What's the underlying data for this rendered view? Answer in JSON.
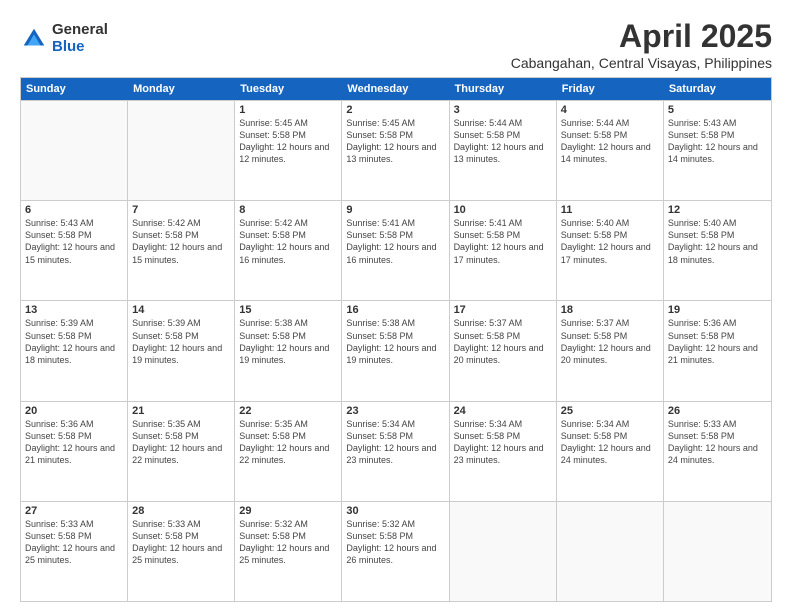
{
  "logo": {
    "general": "General",
    "blue": "Blue"
  },
  "title": "April 2025",
  "location": "Cabangahan, Central Visayas, Philippines",
  "days": [
    "Sunday",
    "Monday",
    "Tuesday",
    "Wednesday",
    "Thursday",
    "Friday",
    "Saturday"
  ],
  "weeks": [
    [
      {
        "day": "",
        "sunrise": "",
        "sunset": "",
        "daylight": ""
      },
      {
        "day": "",
        "sunrise": "",
        "sunset": "",
        "daylight": ""
      },
      {
        "day": "1",
        "sunrise": "Sunrise: 5:45 AM",
        "sunset": "Sunset: 5:58 PM",
        "daylight": "Daylight: 12 hours and 12 minutes."
      },
      {
        "day": "2",
        "sunrise": "Sunrise: 5:45 AM",
        "sunset": "Sunset: 5:58 PM",
        "daylight": "Daylight: 12 hours and 13 minutes."
      },
      {
        "day": "3",
        "sunrise": "Sunrise: 5:44 AM",
        "sunset": "Sunset: 5:58 PM",
        "daylight": "Daylight: 12 hours and 13 minutes."
      },
      {
        "day": "4",
        "sunrise": "Sunrise: 5:44 AM",
        "sunset": "Sunset: 5:58 PM",
        "daylight": "Daylight: 12 hours and 14 minutes."
      },
      {
        "day": "5",
        "sunrise": "Sunrise: 5:43 AM",
        "sunset": "Sunset: 5:58 PM",
        "daylight": "Daylight: 12 hours and 14 minutes."
      }
    ],
    [
      {
        "day": "6",
        "sunrise": "Sunrise: 5:43 AM",
        "sunset": "Sunset: 5:58 PM",
        "daylight": "Daylight: 12 hours and 15 minutes."
      },
      {
        "day": "7",
        "sunrise": "Sunrise: 5:42 AM",
        "sunset": "Sunset: 5:58 PM",
        "daylight": "Daylight: 12 hours and 15 minutes."
      },
      {
        "day": "8",
        "sunrise": "Sunrise: 5:42 AM",
        "sunset": "Sunset: 5:58 PM",
        "daylight": "Daylight: 12 hours and 16 minutes."
      },
      {
        "day": "9",
        "sunrise": "Sunrise: 5:41 AM",
        "sunset": "Sunset: 5:58 PM",
        "daylight": "Daylight: 12 hours and 16 minutes."
      },
      {
        "day": "10",
        "sunrise": "Sunrise: 5:41 AM",
        "sunset": "Sunset: 5:58 PM",
        "daylight": "Daylight: 12 hours and 17 minutes."
      },
      {
        "day": "11",
        "sunrise": "Sunrise: 5:40 AM",
        "sunset": "Sunset: 5:58 PM",
        "daylight": "Daylight: 12 hours and 17 minutes."
      },
      {
        "day": "12",
        "sunrise": "Sunrise: 5:40 AM",
        "sunset": "Sunset: 5:58 PM",
        "daylight": "Daylight: 12 hours and 18 minutes."
      }
    ],
    [
      {
        "day": "13",
        "sunrise": "Sunrise: 5:39 AM",
        "sunset": "Sunset: 5:58 PM",
        "daylight": "Daylight: 12 hours and 18 minutes."
      },
      {
        "day": "14",
        "sunrise": "Sunrise: 5:39 AM",
        "sunset": "Sunset: 5:58 PM",
        "daylight": "Daylight: 12 hours and 19 minutes."
      },
      {
        "day": "15",
        "sunrise": "Sunrise: 5:38 AM",
        "sunset": "Sunset: 5:58 PM",
        "daylight": "Daylight: 12 hours and 19 minutes."
      },
      {
        "day": "16",
        "sunrise": "Sunrise: 5:38 AM",
        "sunset": "Sunset: 5:58 PM",
        "daylight": "Daylight: 12 hours and 19 minutes."
      },
      {
        "day": "17",
        "sunrise": "Sunrise: 5:37 AM",
        "sunset": "Sunset: 5:58 PM",
        "daylight": "Daylight: 12 hours and 20 minutes."
      },
      {
        "day": "18",
        "sunrise": "Sunrise: 5:37 AM",
        "sunset": "Sunset: 5:58 PM",
        "daylight": "Daylight: 12 hours and 20 minutes."
      },
      {
        "day": "19",
        "sunrise": "Sunrise: 5:36 AM",
        "sunset": "Sunset: 5:58 PM",
        "daylight": "Daylight: 12 hours and 21 minutes."
      }
    ],
    [
      {
        "day": "20",
        "sunrise": "Sunrise: 5:36 AM",
        "sunset": "Sunset: 5:58 PM",
        "daylight": "Daylight: 12 hours and 21 minutes."
      },
      {
        "day": "21",
        "sunrise": "Sunrise: 5:35 AM",
        "sunset": "Sunset: 5:58 PM",
        "daylight": "Daylight: 12 hours and 22 minutes."
      },
      {
        "day": "22",
        "sunrise": "Sunrise: 5:35 AM",
        "sunset": "Sunset: 5:58 PM",
        "daylight": "Daylight: 12 hours and 22 minutes."
      },
      {
        "day": "23",
        "sunrise": "Sunrise: 5:34 AM",
        "sunset": "Sunset: 5:58 PM",
        "daylight": "Daylight: 12 hours and 23 minutes."
      },
      {
        "day": "24",
        "sunrise": "Sunrise: 5:34 AM",
        "sunset": "Sunset: 5:58 PM",
        "daylight": "Daylight: 12 hours and 23 minutes."
      },
      {
        "day": "25",
        "sunrise": "Sunrise: 5:34 AM",
        "sunset": "Sunset: 5:58 PM",
        "daylight": "Daylight: 12 hours and 24 minutes."
      },
      {
        "day": "26",
        "sunrise": "Sunrise: 5:33 AM",
        "sunset": "Sunset: 5:58 PM",
        "daylight": "Daylight: 12 hours and 24 minutes."
      }
    ],
    [
      {
        "day": "27",
        "sunrise": "Sunrise: 5:33 AM",
        "sunset": "Sunset: 5:58 PM",
        "daylight": "Daylight: 12 hours and 25 minutes."
      },
      {
        "day": "28",
        "sunrise": "Sunrise: 5:33 AM",
        "sunset": "Sunset: 5:58 PM",
        "daylight": "Daylight: 12 hours and 25 minutes."
      },
      {
        "day": "29",
        "sunrise": "Sunrise: 5:32 AM",
        "sunset": "Sunset: 5:58 PM",
        "daylight": "Daylight: 12 hours and 25 minutes."
      },
      {
        "day": "30",
        "sunrise": "Sunrise: 5:32 AM",
        "sunset": "Sunset: 5:58 PM",
        "daylight": "Daylight: 12 hours and 26 minutes."
      },
      {
        "day": "",
        "sunrise": "",
        "sunset": "",
        "daylight": ""
      },
      {
        "day": "",
        "sunrise": "",
        "sunset": "",
        "daylight": ""
      },
      {
        "day": "",
        "sunrise": "",
        "sunset": "",
        "daylight": ""
      }
    ]
  ]
}
